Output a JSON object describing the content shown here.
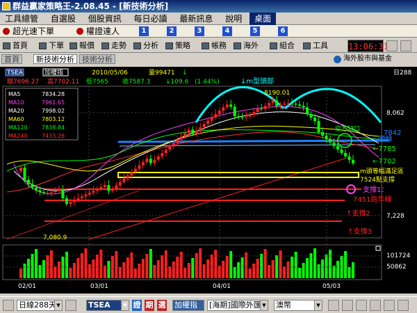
{
  "window": {
    "title": "群益贏家策略王-2.08.45 - [新技術分析]"
  },
  "menu": {
    "items": [
      "工具總管",
      "自選股",
      "個股資訊",
      "每日必讀",
      "最新訊息",
      "說明"
    ],
    "desktop_label": "桌面"
  },
  "linkbar": {
    "item1": "超光速下單",
    "item2": "權證達人",
    "numbers": [
      "1",
      "2",
      "3",
      "4",
      "5",
      "6"
    ]
  },
  "toolbar": {
    "buttons": [
      "首頁",
      "下單",
      "報價",
      "走勢",
      "分析",
      "策略",
      "帳務",
      "海外",
      "組合",
      "工具"
    ],
    "clock": "13:06:31"
  },
  "tabs": [
    "首頁",
    "新技術分析",
    "技術分析"
  ],
  "foreign_link": "海外股市與基金",
  "chart_header": {
    "symbol": "TSEA",
    "index_name": "加權指",
    "date": "2010/05/06",
    "volume_label": "量99471",
    "open": "開7696.27",
    "high": "高7702.11",
    "low": "低7565",
    "close": "收7587.3",
    "change": "109.6",
    "change_pct": "(1.44%)",
    "period": "日288"
  },
  "ma_legend": [
    {
      "name": "MA5",
      "value": "7834.28",
      "color": "#ffffff"
    },
    {
      "name": "MA10",
      "value": "7961.65",
      "color": "#ff40ff"
    },
    {
      "name": "MA20",
      "value": "7998.02",
      "color": "#ffffff"
    },
    {
      "name": "MA60",
      "value": "7803.12",
      "color": "#ffff00"
    },
    {
      "name": "MA120",
      "value": "7838.84",
      "color": "#00ff00"
    },
    {
      "name": "MA240",
      "value": "7433.26",
      "color": "#ff3030"
    }
  ],
  "annotations": {
    "m_top": "↓m型頭部",
    "peak": "8190.01",
    "gap": "空方缺口",
    "gap_value": "7842",
    "neckline": "←頸線",
    "p7785": "←7785",
    "p7702": "←7702",
    "m_target_1": "m頭等幅滿足區",
    "m_target_2": "7524點支撐",
    "support1_a": "支撐1：",
    "support1_b": "7451跑年線",
    "support2": "↑支撐2",
    "support3": "↑支撐3",
    "low_label": "7,080.9"
  },
  "price_axis": [
    "8,062",
    "7,228"
  ],
  "volume_axis": [
    "101724",
    "50862"
  ],
  "date_axis": [
    "02/01",
    "03/01",
    "04/01",
    "05/03"
  ],
  "chart_data": {
    "type": "candlestick",
    "title": "加權指",
    "symbol": "TSEA",
    "period": "daily",
    "last_bar": {
      "date": "2010/05/06",
      "open": 7696.27,
      "high": 7702.11,
      "low": 7565,
      "close": 7587.3,
      "change": -109.6,
      "change_pct": -1.44,
      "volume": 99471
    },
    "moving_averages": {
      "MA5": 7834.28,
      "MA10": 7961.65,
      "MA20": 7998.02,
      "MA60": 7803.12,
      "MA120": 7838.84,
      "MA240": 7433.26
    },
    "marked_high": 8190.01,
    "marked_low": 7080.9,
    "price_ticks": [
      8062,
      7228
    ],
    "volume_ticks": [
      101724,
      50862
    ],
    "x_ticks": [
      "02/01",
      "03/01",
      "04/01",
      "05/03"
    ],
    "levels": {
      "gap": 7842,
      "p7785": 7785,
      "p7702": 7702,
      "m_support": 7524,
      "annual_line": 7451
    },
    "ylim": [
      6960,
      8300
    ]
  },
  "statusbar": {
    "period": "日線288天",
    "symbol": "TSEA",
    "btn1": "證",
    "btn2": "期",
    "btn3": "選",
    "index": "加權指",
    "market": "[海期]國際外匯",
    "dropdown": "澳幣"
  }
}
